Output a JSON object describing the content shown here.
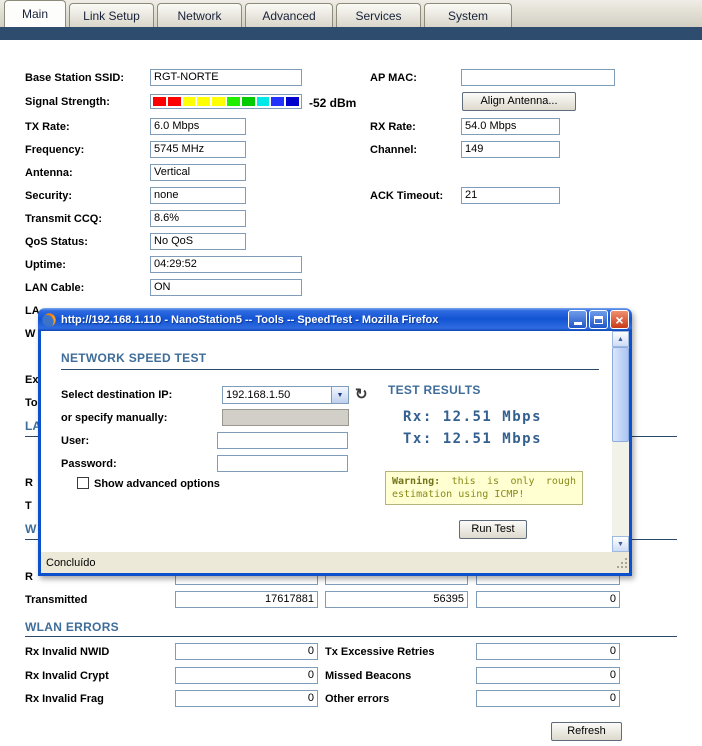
{
  "tabs": [
    "Main",
    "Link Setup",
    "Network",
    "Advanced",
    "Services",
    "System"
  ],
  "active_tab": "Main",
  "status": {
    "base_station_ssid_label": "Base Station SSID:",
    "base_station_ssid": "RGT-NORTE",
    "ap_mac_label": "AP MAC:",
    "ap_mac": "",
    "signal_strength_label": "Signal Strength:",
    "signal_dbm": "-52 dBm",
    "signal_colors": [
      "#ff0000",
      "#ff0000",
      "#ffff00",
      "#ffff00",
      "#ffff00",
      "#22ee00",
      "#00cc00",
      "#00e8e8",
      "#2233ff",
      "#0000cc"
    ],
    "align_antenna_button": "Align Antenna...",
    "tx_rate_label": "TX Rate:",
    "tx_rate": "6.0 Mbps",
    "rx_rate_label": "RX Rate:",
    "rx_rate": "54.0 Mbps",
    "frequency_label": "Frequency:",
    "frequency": "5745 MHz",
    "channel_label": "Channel:",
    "channel": "149",
    "antenna_label": "Antenna:",
    "antenna": "Vertical",
    "security_label": "Security:",
    "security": "none",
    "ack_timeout_label": "ACK Timeout:",
    "ack_timeout": "21",
    "transmit_ccq_label": "Transmit CCQ:",
    "transmit_ccq": "8.6%",
    "qos_status_label": "QoS Status:",
    "qos_status": "No QoS",
    "uptime_label": "Uptime:",
    "uptime": "04:29:52",
    "lan_cable_label": "LAN Cable:",
    "lan_cable": "ON"
  },
  "obscured": {
    "fragments": [
      "LA",
      "W",
      "Ex",
      "To",
      "LA",
      "R",
      "T",
      "W",
      "R"
    ]
  },
  "stats": {
    "transmitted_label": "Transmitted",
    "transmitted_values": [
      "17617881",
      "56395",
      "0"
    ]
  },
  "wlan_errors": {
    "heading": "WLAN ERRORS",
    "rows": [
      {
        "left_label": "Rx Invalid NWID",
        "left_value": "0",
        "right_label": "Tx Excessive Retries",
        "right_value": "0"
      },
      {
        "left_label": "Rx Invalid Crypt",
        "left_value": "0",
        "right_label": "Missed Beacons",
        "right_value": "0"
      },
      {
        "left_label": "Rx Invalid Frag",
        "left_value": "0",
        "right_label": "Other errors",
        "right_value": "0"
      }
    ],
    "refresh_button": "Refresh"
  },
  "popup": {
    "title": "http://192.168.1.110 - NanoStation5 -- Tools -- SpeedTest - Mozilla Firefox",
    "heading": "NETWORK SPEED TEST",
    "labels": {
      "select_destination": "Select destination IP:",
      "specify_manually": "or specify manually:",
      "user": "User:",
      "password": "Password:",
      "show_advanced": "Show advanced options"
    },
    "destination_ip": "192.168.1.50",
    "results": {
      "heading": "TEST RESULTS",
      "rx": "Rx: 12.51 Mbps",
      "tx": "Tx: 12.51 Mbps"
    },
    "warning_label": "Warning:",
    "warning_text": "this is only rough estimation using ICMP!",
    "run_test_button": "Run Test",
    "statusbar": "Concluído"
  },
  "colors": {
    "section_heading": "#3f6d99",
    "section_rule": "#29496b",
    "header_bar": "#2e4d6e",
    "titlebar_blue": "#1254d4",
    "close_button_red": "#c83a18",
    "warning_bg": "#ffffd2"
  }
}
